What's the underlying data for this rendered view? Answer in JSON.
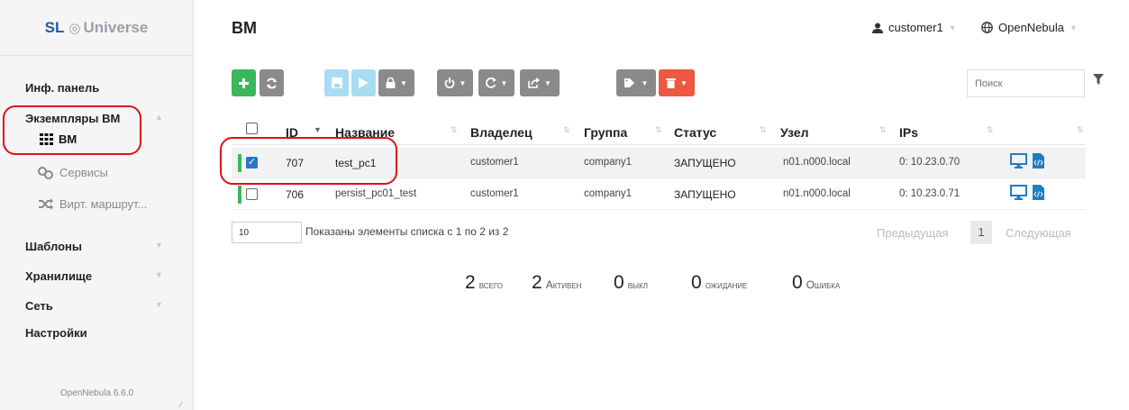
{
  "brand": {
    "prefix": "SL",
    "name": "Universe"
  },
  "sidebar": {
    "items": [
      {
        "label": "Инф. панель"
      },
      {
        "label": "Экземпляры ВМ"
      },
      {
        "label": "Шаблоны"
      },
      {
        "label": "Хранилище"
      },
      {
        "label": "Сеть"
      },
      {
        "label": "Настройки"
      }
    ],
    "sub_items": [
      {
        "label": "ВМ",
        "icon": "grid-icon"
      },
      {
        "label": "Сервисы",
        "icon": "services-icon"
      },
      {
        "label": "Вирт. маршрут...",
        "icon": "shuffle-icon"
      }
    ],
    "version": "OpenNebula 6.6.0"
  },
  "header": {
    "title": "ВМ",
    "user": "customer1",
    "zone": "OpenNebula"
  },
  "search": {
    "placeholder": "Поиск"
  },
  "table": {
    "columns": [
      "ID",
      "Название",
      "Владелец",
      "Группа",
      "Статус",
      "Узел",
      "IPs"
    ],
    "rows": [
      {
        "id": "707",
        "name": "test_pc1",
        "owner": "customer1",
        "group": "company1",
        "status": "ЗАПУЩЕНО",
        "host": "n01.n000.local",
        "ips": "0: 10.23.0.70",
        "selected": true
      },
      {
        "id": "706",
        "name": "persist_pc01_test",
        "owner": "customer1",
        "group": "company1",
        "status": "ЗАПУЩЕНО",
        "host": "n01.n000.local",
        "ips": "0: 10.23.0.71",
        "selected": false
      }
    ]
  },
  "pagination": {
    "page_size": "10",
    "info": "Показаны элементы списка с 1 по 2 из 2",
    "prev": "Предыдущая",
    "current": "1",
    "next": "Следующая"
  },
  "summary": [
    {
      "count": "2",
      "label": "всего"
    },
    {
      "count": "2",
      "label": "Активен"
    },
    {
      "count": "0",
      "label": "выкл"
    },
    {
      "count": "0",
      "label": "ожидание"
    },
    {
      "count": "0",
      "label": "Ошибка"
    }
  ],
  "colors": {
    "green": "#3cb65a",
    "red_highlight": "#e0101a",
    "link_blue": "#2477c9"
  }
}
